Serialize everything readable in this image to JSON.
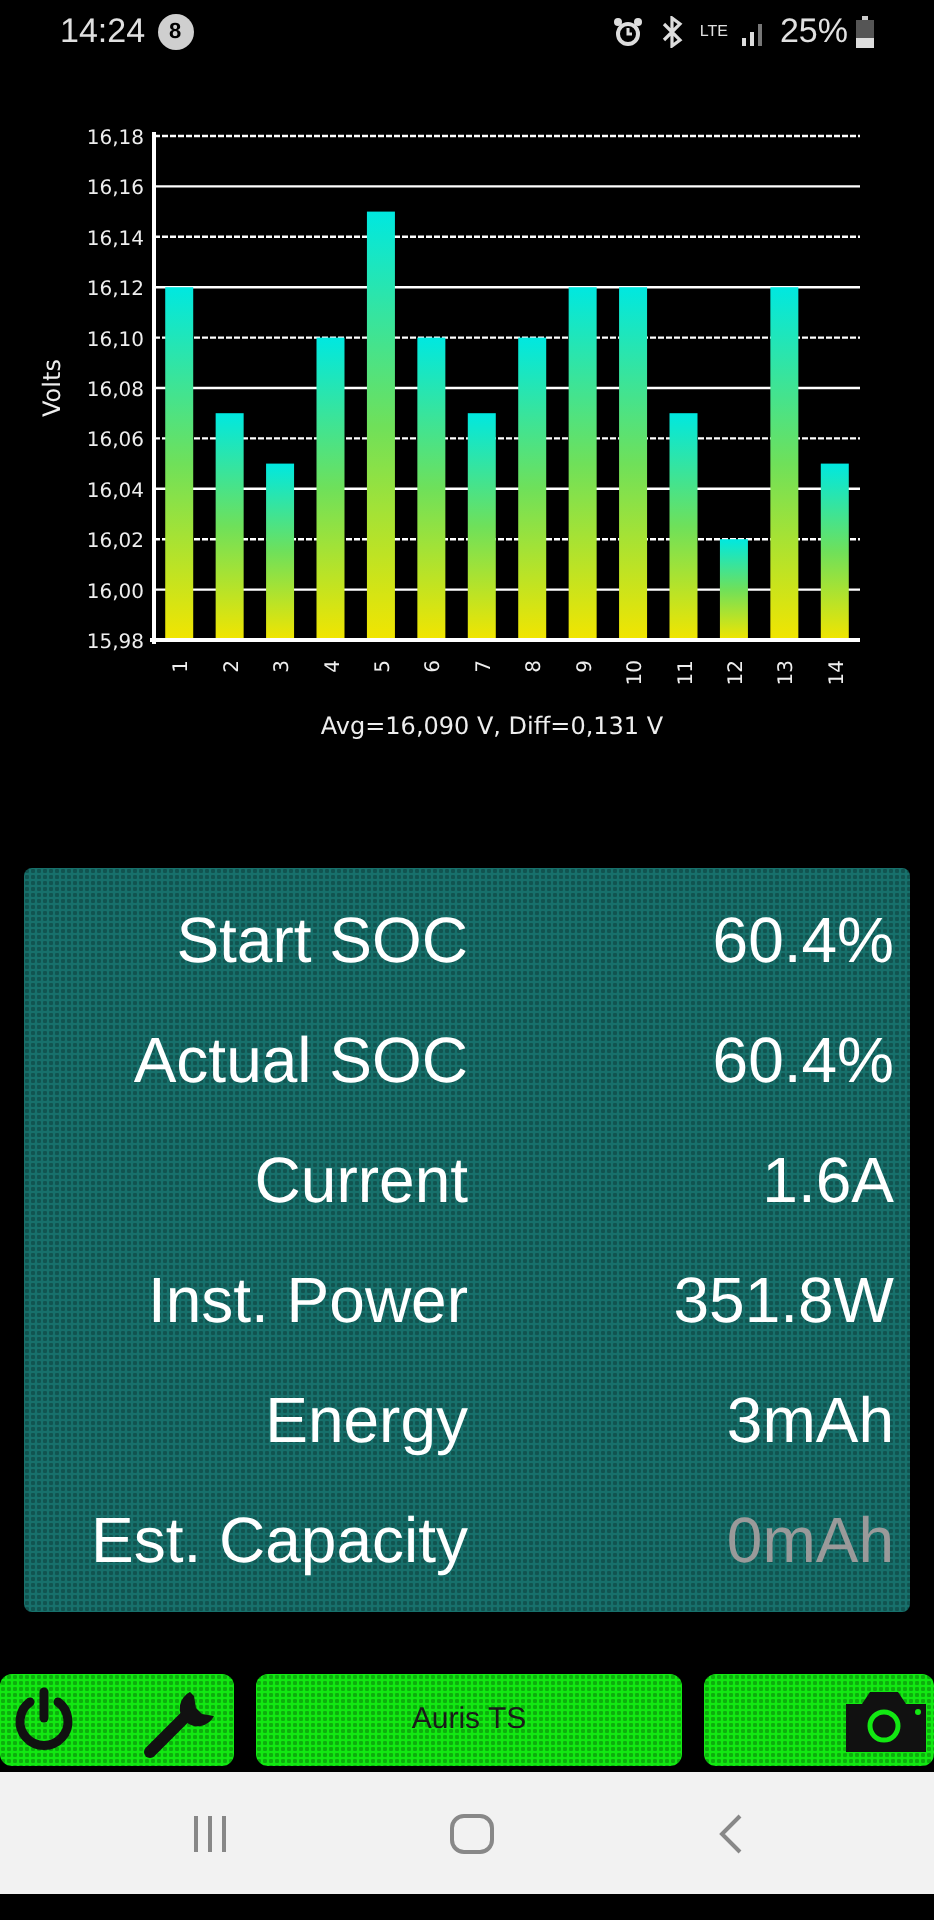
{
  "status_bar": {
    "time": "14:24",
    "notification_count": "8",
    "network": "LTE",
    "battery": "25%"
  },
  "chart": {
    "chart_data": {
      "type": "bar",
      "grid": true,
      "ylabel": "Volts",
      "categories": [
        "1",
        "2",
        "3",
        "4",
        "5",
        "6",
        "7",
        "8",
        "9",
        "10",
        "11",
        "12",
        "13",
        "14"
      ],
      "values": [
        16.12,
        16.07,
        16.05,
        16.1,
        16.15,
        16.1,
        16.07,
        16.1,
        16.12,
        16.12,
        16.07,
        16.02,
        16.12,
        16.05
      ],
      "ylim": [
        15.98,
        16.18
      ],
      "yticks": [
        {
          "value": 15.98,
          "label": "15,98"
        },
        {
          "value": 16.0,
          "label": "16,00"
        },
        {
          "value": 16.02,
          "label": "16,02"
        },
        {
          "value": 16.04,
          "label": "16,04"
        },
        {
          "value": 16.06,
          "label": "16,06"
        },
        {
          "value": 16.08,
          "label": "16,08"
        },
        {
          "value": 16.1,
          "label": "16,10"
        },
        {
          "value": 16.12,
          "label": "16,12"
        },
        {
          "value": 16.14,
          "label": "16,14"
        },
        {
          "value": 16.16,
          "label": "16,16"
        },
        {
          "value": 16.18,
          "label": "16,18"
        }
      ]
    },
    "summary": "Avg=16,090 V, Diff=0,131 V"
  },
  "stats": [
    {
      "label": "Start SOC",
      "value": "60.4%",
      "dimmed": false
    },
    {
      "label": "Actual SOC",
      "value": "60.4%",
      "dimmed": false
    },
    {
      "label": "Current",
      "value": "1.6A",
      "dimmed": false
    },
    {
      "label": "Inst. Power",
      "value": "351.8W",
      "dimmed": false
    },
    {
      "label": "Energy",
      "value": "3mAh",
      "dimmed": false
    },
    {
      "label": "Est. Capacity",
      "value": "0mAh",
      "dimmed": true
    }
  ],
  "bottom_bar": {
    "title": "Auris TS"
  }
}
